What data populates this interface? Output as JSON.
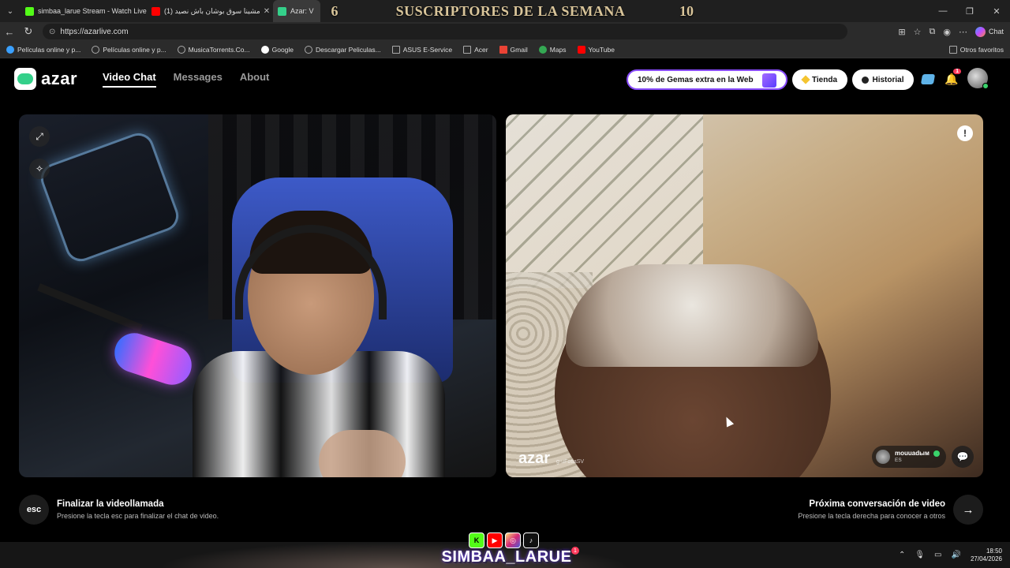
{
  "browser": {
    "tabs": [
      {
        "label": "simbaa_larue Stream - Watch Live",
        "favicon_color": "#53fc18"
      },
      {
        "label": "مشينا سوق بوشان باش نصيد (1)",
        "favicon_color": "#ff0000"
      },
      {
        "label": "Azar: V",
        "favicon_color": "#34d08a"
      }
    ],
    "url": "https://azarlive.com",
    "chat_label": "Chat",
    "bookmarks": [
      {
        "label": "Películas online y p...",
        "icon_color": "#3aa0ff"
      },
      {
        "label": "Películas online y p...",
        "icon_color": "#aaaaaa"
      },
      {
        "label": "MusicaTorrents.Co...",
        "icon_color": "#aaaaaa"
      },
      {
        "label": "Google",
        "icon_color": "#ffffff"
      },
      {
        "label": "Descargar Peliculas...",
        "icon_color": "#aaaaaa"
      },
      {
        "label": "ASUS E-Service",
        "icon_color": "#aaaaaa"
      },
      {
        "label": "Acer",
        "icon_color": "#aaaaaa"
      },
      {
        "label": "Gmail",
        "icon_color": "#ea4335"
      },
      {
        "label": "Maps",
        "icon_color": "#34a853"
      },
      {
        "label": "YouTube",
        "icon_color": "#ff0000"
      }
    ],
    "other_bookmarks": "Otros favoritos"
  },
  "stream_banner": {
    "left_number": "6",
    "title": "SUSCRIPTORES DE LA SEMANA",
    "right_number": "10"
  },
  "azar": {
    "logo_text": "azar",
    "nav": [
      {
        "label": "Video Chat",
        "active": true
      },
      {
        "label": "Messages",
        "active": false
      },
      {
        "label": "About",
        "active": false
      }
    ],
    "promo": "10% de Gemas extra en la Web",
    "shop_label": "Tienda",
    "history_label": "Historial",
    "notification_count": "1"
  },
  "video_right": {
    "watermark": "azar",
    "watermark_id": "g-uFotiaSV",
    "partner_name": "mouuadым",
    "partner_country": "ES"
  },
  "footer": {
    "esc_key": "esc",
    "end_title": "Finalizar la videollamada",
    "end_sub": "Presione la tecla esc para finalizar el chat de video.",
    "next_title": "Próxima conversación de video",
    "next_sub": "Presione la tecla derecha para conocer a otros"
  },
  "stream_brand": {
    "name": "SIMBAA_LARUE",
    "badge": "1"
  },
  "taskbar": {
    "time": "18:50",
    "date": "27/04/2026"
  }
}
